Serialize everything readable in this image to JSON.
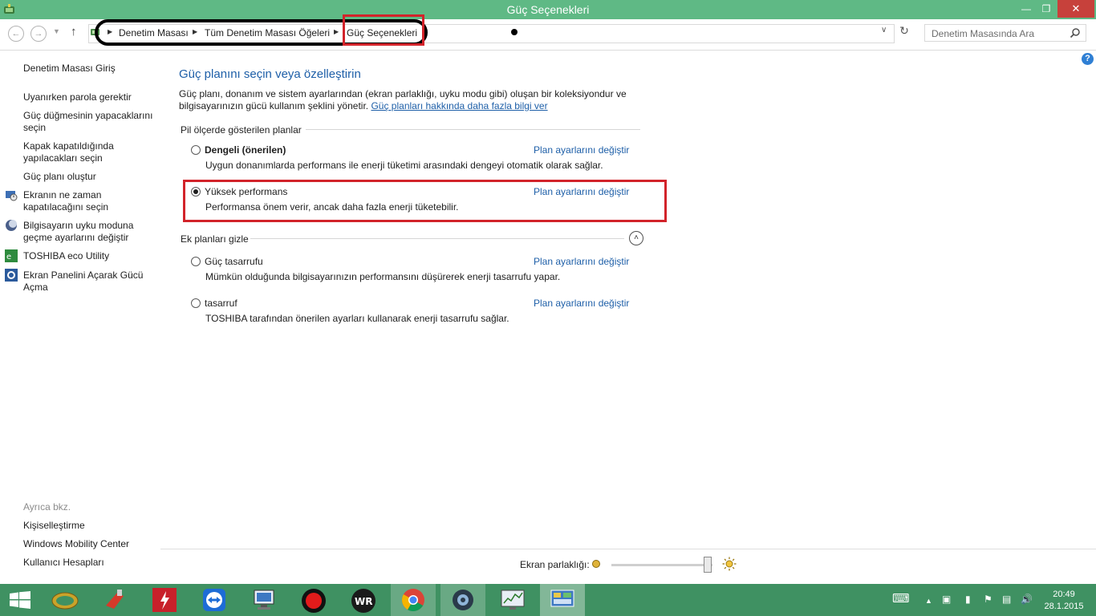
{
  "window": {
    "title": "Güç Seçenekleri",
    "minimize_glyph": "—",
    "restore_glyph": "❐",
    "close_glyph": "✕"
  },
  "nav": {
    "back_glyph": "←",
    "forward_glyph": "→",
    "recent_glyph": "▼",
    "up_glyph": "↑",
    "breadcrumb": [
      "Denetim Masası",
      "Tüm Denetim Masası Öğeleri",
      "Güç Seçenekleri"
    ],
    "breadcrumb_sep": "▶",
    "dropdown_glyph": "∨",
    "refresh_glyph": "↻",
    "search_placeholder": "Denetim Masasında Ara"
  },
  "help_glyph": "?",
  "sidebar": {
    "home": "Denetim Masası Giriş",
    "items": [
      "Uyanırken parola gerektir",
      "Güç düğmesinin yapacaklarını seçin",
      "Kapak kapatıldığında yapılacakları seçin",
      "Güç planı oluştur",
      "Ekranın ne zaman kapatılacağını seçin",
      "Bilgisayarın uyku moduna geçme ayarlarını değiştir",
      "TOSHIBA eco Utility",
      "Ekran Panelini Açarak Gücü Açma"
    ],
    "see_also": "Ayrıca bkz.",
    "see_also_items": [
      "Kişiselleştirme",
      "Windows Mobility Center",
      "Kullanıcı Hesapları"
    ]
  },
  "main": {
    "heading": "Güç planını seçin veya özelleştirin",
    "description": "Güç planı, donanım ve sistem ayarlarından (ekran parlaklığı, uyku modu gibi) oluşan bir koleksiyondur ve bilgisayarınızın gücü kullanım şeklini yönetir.",
    "learn_more": "Güç planları hakkında daha fazla bilgi ver",
    "group_shown": "Pil ölçerde gösterilen planlar",
    "group_hidden": "Ek planları gizle",
    "collapse_glyph": "˄",
    "plans": [
      {
        "name": "Dengeli (önerilen)",
        "desc": "Uygun donanımlarda performans ile enerji tüketimi arasındaki dengeyi otomatik olarak sağlar.",
        "link": "Plan ayarlarını değiştir",
        "selected": false
      },
      {
        "name": "Yüksek performans",
        "desc": "Performansa önem verir, ancak daha fazla enerji tüketebilir.",
        "link": "Plan ayarlarını değiştir",
        "selected": true
      },
      {
        "name": "Güç tasarrufu",
        "desc": "Mümkün olduğunda bilgisayarınızın performansını düşürerek enerji tasarrufu yapar.",
        "link": "Plan ayarlarını değiştir",
        "selected": false
      },
      {
        "name": "tasarruf",
        "desc": "TOSHIBA tarafından önerilen ayarları kullanarak enerji tasarrufu sağlar.",
        "link": "Plan ayarlarını değiştir",
        "selected": false
      }
    ]
  },
  "brightness": {
    "label": "Ekran parlaklığı:",
    "level": 0.95
  },
  "taskbar": {
    "apps": [
      "start-button",
      "winrar-icon",
      "ccleaner-icon",
      "flash-icon",
      "teamviewer-icon",
      "computer-icon",
      "recorder-icon",
      "wr-icon",
      "chrome-icon",
      "media-icon",
      "monitor-icon",
      "control-panel-icon"
    ],
    "tray_glyphs": [
      "⌨",
      "▲",
      "▣",
      "▮",
      "⚑",
      "▤",
      "🔊"
    ],
    "time": "20:49",
    "date": "28.1.2015"
  },
  "colors": {
    "titlebar": "#5fb985",
    "close": "#c7413b",
    "link": "#1e5fa8",
    "highlight": "#d2232a",
    "taskbar": "#3f9162"
  }
}
